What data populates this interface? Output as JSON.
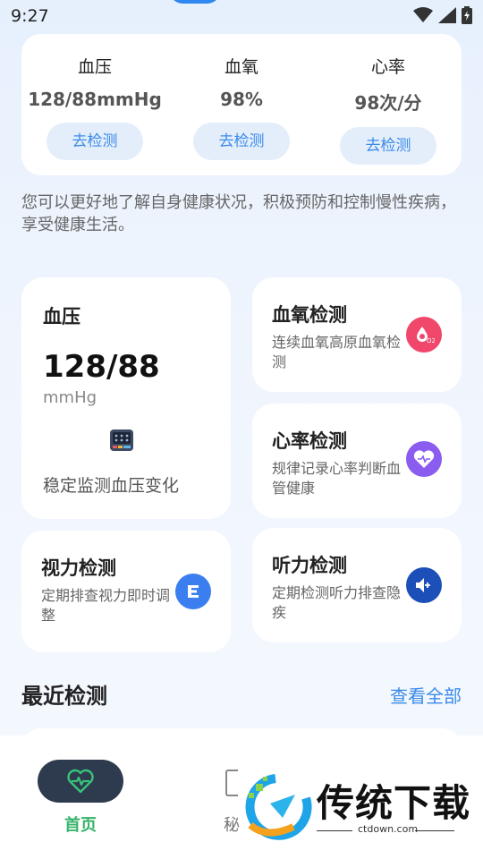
{
  "status_bar": {
    "time": "9:27"
  },
  "metrics": [
    {
      "label": "血压",
      "value": "128/88mmHg",
      "button": "去检测"
    },
    {
      "label": "血氧",
      "value": "98%",
      "button": "去检测"
    },
    {
      "label": "心率",
      "value": "98次/分",
      "button": "去检测"
    }
  ],
  "intro": "您可以更好地了解自身健康状况，积极预防和控制慢性疾病，享受健康生活。",
  "cards": {
    "bp": {
      "title": "血压",
      "value": "128/88",
      "unit": "mmHg",
      "desc": "稳定监测血压变化"
    },
    "spo2": {
      "title": "血氧检测",
      "desc": "连续血氧高原血氧检测",
      "icon": "blood-drop-o2-icon",
      "color": "#f0476b"
    },
    "hr": {
      "title": "心率检测",
      "desc": "规律记录心率判断血管健康",
      "icon": "heart-pulse-icon",
      "color": "#8a5cf0"
    },
    "vision": {
      "title": "视力检测",
      "desc": "定期排查视力即时调整",
      "icon": "eye-chart-icon",
      "color": "#3a7ef0"
    },
    "hearing": {
      "title": "听力检测",
      "desc": "定期检测听力排查隐疾",
      "icon": "speaker-icon",
      "color": "#1c4fb8"
    }
  },
  "recent": {
    "title": "最近检测",
    "see_all": "查看全部"
  },
  "bottom_nav": {
    "home_label": "首页",
    "second_label": "秘"
  },
  "watermark": {
    "text": "传统下载",
    "sub": "ctdown.com"
  }
}
